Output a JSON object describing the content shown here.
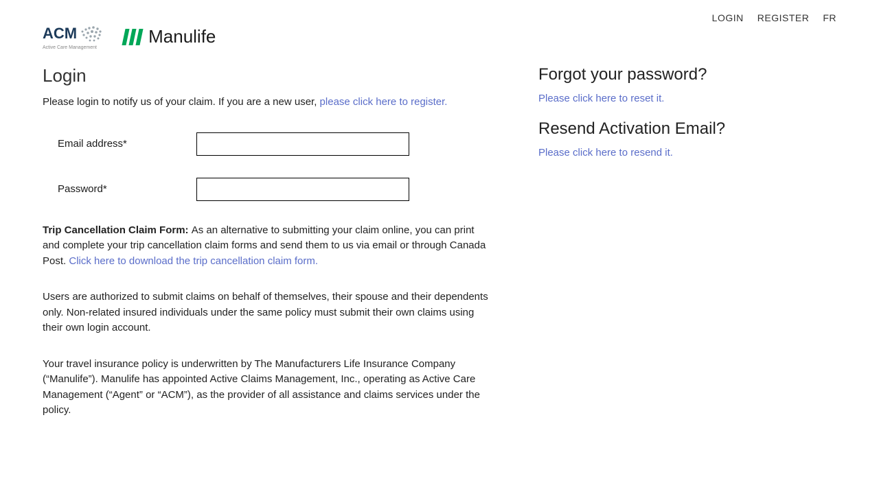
{
  "nav": {
    "login": "LOGIN",
    "register": "REGISTER",
    "lang": "FR"
  },
  "logos": {
    "acm": "ACM",
    "acm_sub": "Active Care Management",
    "manulife": "Manulife"
  },
  "login": {
    "heading": "Login",
    "subtext_prefix": "Please login to notify us of your claim. If you are a new user, ",
    "subtext_link": "please click here to register.",
    "email_label": "Email address*",
    "password_label": "Password*"
  },
  "info": {
    "cancel_bold": "Trip Cancellation Claim Form: ",
    "cancel_text": "As an alternative to submitting your claim online, you can print and complete your trip cancellation claim forms and send them to us via email or through Canada Post. ",
    "cancel_link": "Click here to download the trip cancellation claim form.",
    "auth_text": "Users are authorized to submit claims on behalf of themselves, their spouse and their dependents only. Non-related insured individuals under the same policy must submit their own claims using their own login account.",
    "underwriter_text": "Your travel insurance policy is underwritten by The Manufacturers Life Insurance Company (“Manulife”). Manulife has appointed Active Claims Management, Inc., operating as Active Care Management (“Agent” or “ACM”), as the provider of all assistance and claims services under the policy."
  },
  "right": {
    "forgot_heading": "Forgot your password?",
    "forgot_link": "Please click here to reset it.",
    "resend_heading": "Resend Activation Email?",
    "resend_link": "Please click here to resend it."
  }
}
